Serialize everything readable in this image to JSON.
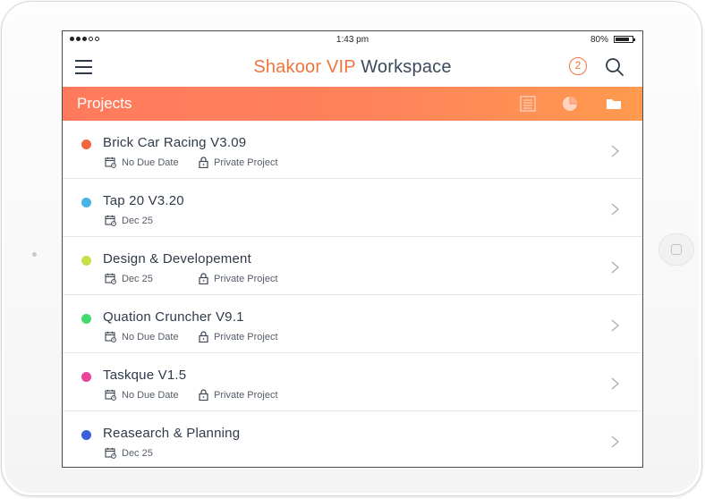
{
  "status_bar": {
    "time": "1:43 pm",
    "battery": "80%"
  },
  "header": {
    "title_part1": "Shakoor VIP",
    "title_part2": "Workspace",
    "notification_count": "2"
  },
  "projects_bar": {
    "label": "Projects",
    "icons": [
      "list-view-icon",
      "pie-chart-icon",
      "folder-icon"
    ]
  },
  "projects": [
    {
      "name": "Brick Car Racing V3.09",
      "due": "No Due Date",
      "privacy": "Private Project",
      "color": "#f0673f"
    },
    {
      "name": "Tap 20 V3.20",
      "due": "Dec 25",
      "privacy": "",
      "color": "#49b2e6"
    },
    {
      "name": "Design & Developement",
      "due": "Dec 25",
      "privacy": "Private Project",
      "color": "#c5e14a"
    },
    {
      "name": "Quation Cruncher V9.1",
      "due": "No Due Date",
      "privacy": "Private Project",
      "color": "#45d96b"
    },
    {
      "name": "Taskque V1.5",
      "due": "No Due Date",
      "privacy": "Private Project",
      "color": "#e8449a"
    },
    {
      "name": "Reasearch & Planning",
      "due": "Dec 25",
      "privacy": "",
      "color": "#3b5fd8"
    }
  ],
  "colors": {
    "accent": "#f0743e",
    "text": "#2f3a4a"
  }
}
